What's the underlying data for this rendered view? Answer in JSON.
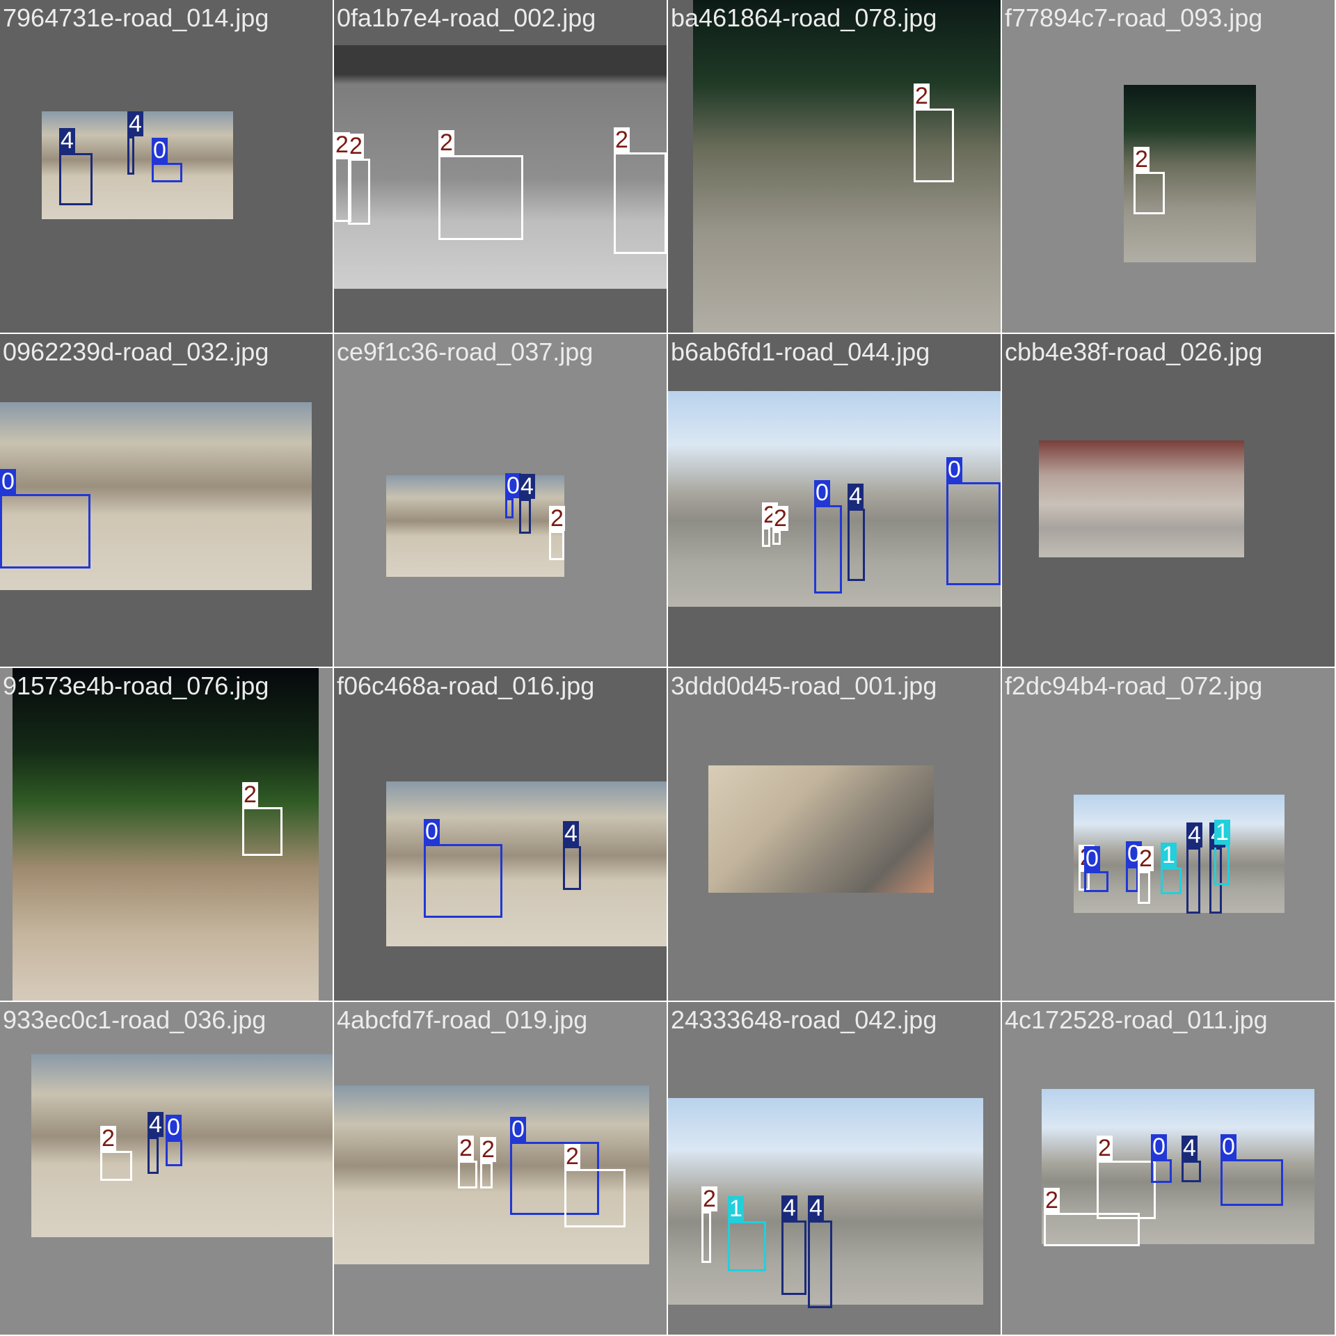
{
  "classes": {
    "0": {
      "box_color": "#2137d6",
      "label_bg": "#2137d6",
      "label_fg": "#ffffff"
    },
    "1": {
      "box_color": "#22cfdc",
      "label_bg": "#22cfdc",
      "label_fg": "#ffffff"
    },
    "2": {
      "box_color": "#ffffff",
      "label_bg": "#ffffff",
      "label_fg": "#7a1a12"
    },
    "4": {
      "box_color": "#1a2a7a",
      "label_bg": "#1a2a7a",
      "label_fg": "#ffffff"
    }
  },
  "tiles": [
    {
      "filename": "7964731e-road_014.jpg",
      "background": "#616161",
      "scene": "street",
      "detections": [
        {
          "class": "4",
          "label": "4"
        },
        {
          "class": "4",
          "label": "4"
        },
        {
          "class": "0",
          "label": "0"
        }
      ]
    },
    {
      "filename": "0fa1b7e4-road_002.jpg",
      "background": "#616161",
      "scene": "wall",
      "detections": [
        {
          "class": "2",
          "label": "2"
        },
        {
          "class": "2",
          "label": "2"
        },
        {
          "class": "2",
          "label": "2"
        },
        {
          "class": "2",
          "label": "2"
        }
      ]
    },
    {
      "filename": "ba461864-road_078.jpg",
      "background": "#616161",
      "scene": "night-road",
      "detections": [
        {
          "class": "2",
          "label": "2"
        }
      ]
    },
    {
      "filename": "f77894c7-road_093.jpg",
      "background": "#8b8b8b",
      "scene": "night-road",
      "detections": [
        {
          "class": "2",
          "label": "2"
        }
      ]
    },
    {
      "filename": "0962239d-road_032.jpg",
      "background": "#616161",
      "scene": "street",
      "detections": [
        {
          "class": "0",
          "label": "0"
        }
      ]
    },
    {
      "filename": "ce9f1c36-road_037.jpg",
      "background": "#8b8b8b",
      "scene": "street",
      "detections": [
        {
          "class": "0",
          "label": "0"
        },
        {
          "class": "4",
          "label": "4"
        },
        {
          "class": "2",
          "label": "2"
        }
      ]
    },
    {
      "filename": "b6ab6fd1-road_044.jpg",
      "background": "#616161",
      "scene": "sky-street",
      "detections": [
        {
          "class": "2",
          "label": "2"
        },
        {
          "class": "2",
          "label": "2"
        },
        {
          "class": "0",
          "label": "0"
        },
        {
          "class": "4",
          "label": "4"
        },
        {
          "class": "0",
          "label": "0"
        }
      ]
    },
    {
      "filename": "cbb4e38f-road_026.jpg",
      "background": "#616161",
      "scene": "buildings",
      "detections": []
    },
    {
      "filename": "91573e4b-road_076.jpg",
      "background": "#8b8b8b",
      "scene": "night-tree",
      "detections": [
        {
          "class": "2",
          "label": "2"
        }
      ]
    },
    {
      "filename": "f06c468a-road_016.jpg",
      "background": "#616161",
      "scene": "street",
      "detections": [
        {
          "class": "0",
          "label": "0"
        },
        {
          "class": "4",
          "label": "4"
        }
      ]
    },
    {
      "filename": "3ddd0d45-road_001.jpg",
      "background": "#7a7a7a",
      "scene": "ground",
      "detections": []
    },
    {
      "filename": "f2dc94b4-road_072.jpg",
      "background": "#8b8b8b",
      "scene": "sky-street",
      "detections": [
        {
          "class": "2",
          "label": "2"
        },
        {
          "class": "0",
          "label": "0"
        },
        {
          "class": "0",
          "label": "0"
        },
        {
          "class": "2",
          "label": "2"
        },
        {
          "class": "1",
          "label": "1"
        },
        {
          "class": "4",
          "label": "4"
        },
        {
          "class": "4",
          "label": "4"
        },
        {
          "class": "1",
          "label": "1"
        }
      ]
    },
    {
      "filename": "933ec0c1-road_036.jpg",
      "background": "#8b8b8b",
      "scene": "street",
      "detections": [
        {
          "class": "2",
          "label": "2"
        },
        {
          "class": "4",
          "label": "4"
        },
        {
          "class": "0",
          "label": "0"
        }
      ]
    },
    {
      "filename": "4abcfd7f-road_019.jpg",
      "background": "#8b8b8b",
      "scene": "street",
      "detections": [
        {
          "class": "2",
          "label": "2"
        },
        {
          "class": "2",
          "label": "2"
        },
        {
          "class": "0",
          "label": "0"
        },
        {
          "class": "2",
          "label": "2"
        }
      ]
    },
    {
      "filename": "24333648-road_042.jpg",
      "background": "#7a7a7a",
      "scene": "sky-street",
      "detections": [
        {
          "class": "2",
          "label": "2"
        },
        {
          "class": "1",
          "label": "1"
        },
        {
          "class": "4",
          "label": "4"
        },
        {
          "class": "4",
          "label": "4"
        }
      ]
    },
    {
      "filename": "4c172528-road_011.jpg",
      "background": "#8b8b8b",
      "scene": "sky-street",
      "detections": [
        {
          "class": "2",
          "label": "2"
        },
        {
          "class": "2",
          "label": "2"
        },
        {
          "class": "0",
          "label": "0"
        },
        {
          "class": "4",
          "label": "4"
        },
        {
          "class": "0",
          "label": "0"
        }
      ]
    }
  ]
}
